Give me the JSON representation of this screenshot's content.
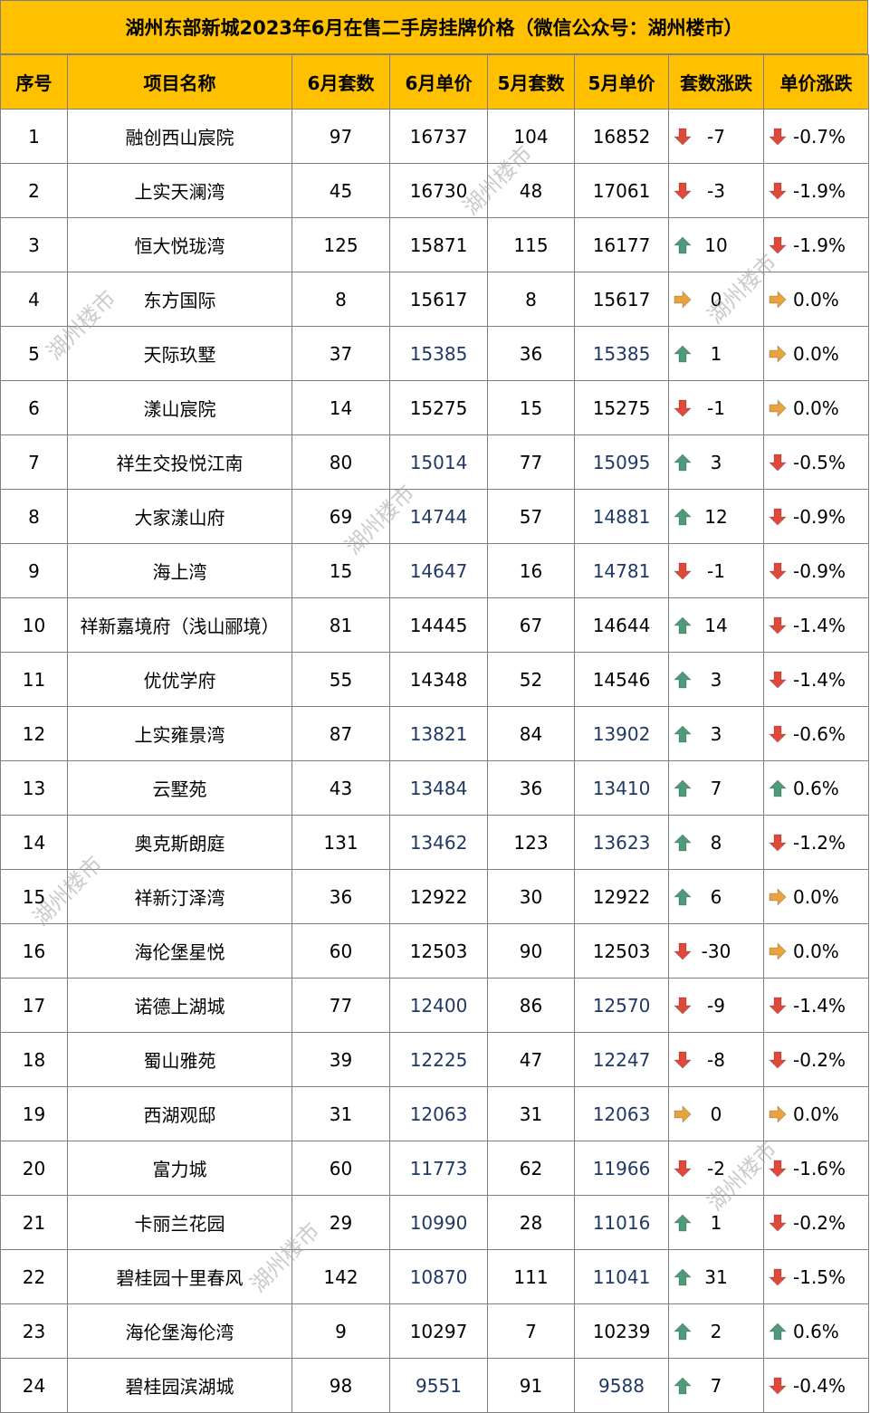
{
  "title": "湖州东部新城2023年6月在售二手房挂牌价格（微信公众号：湖州楼市）",
  "headers": [
    "序号",
    "项目名称",
    "6月套数",
    "6月单价",
    "5月套数",
    "5月单价",
    "套数涨跌",
    "单价涨跌"
  ],
  "watermark_text": "湖州楼市",
  "colors": {
    "header_bg": "#ffc000",
    "up": "#4e9a7a",
    "down": "#e0493a",
    "flat": "#e8a33c",
    "price_blue": "#1f3864"
  },
  "rows": [
    {
      "no": "1",
      "name": "融创西山宸院",
      "jun_count": "97",
      "jun_price": "16737",
      "may_count": "104",
      "may_price": "16852",
      "count_dir": "down",
      "count_change": "-7",
      "price_dir": "down",
      "price_change": "-0.7%",
      "blue": false
    },
    {
      "no": "2",
      "name": "上实天澜湾",
      "jun_count": "45",
      "jun_price": "16730",
      "may_count": "48",
      "may_price": "17061",
      "count_dir": "down",
      "count_change": "-3",
      "price_dir": "down",
      "price_change": "-1.9%",
      "blue": false
    },
    {
      "no": "3",
      "name": "恒大悦珑湾",
      "jun_count": "125",
      "jun_price": "15871",
      "may_count": "115",
      "may_price": "16177",
      "count_dir": "up",
      "count_change": "10",
      "price_dir": "down",
      "price_change": "-1.9%",
      "blue": false
    },
    {
      "no": "4",
      "name": "东方国际",
      "jun_count": "8",
      "jun_price": "15617",
      "may_count": "8",
      "may_price": "15617",
      "count_dir": "flat",
      "count_change": "0",
      "price_dir": "flat",
      "price_change": "0.0%",
      "blue": false
    },
    {
      "no": "5",
      "name": "天际玖墅",
      "jun_count": "37",
      "jun_price": "15385",
      "may_count": "36",
      "may_price": "15385",
      "count_dir": "up",
      "count_change": "1",
      "price_dir": "flat",
      "price_change": "0.0%",
      "blue": true
    },
    {
      "no": "6",
      "name": "漾山宸院",
      "jun_count": "14",
      "jun_price": "15275",
      "may_count": "15",
      "may_price": "15275",
      "count_dir": "down",
      "count_change": "-1",
      "price_dir": "flat",
      "price_change": "0.0%",
      "blue": false
    },
    {
      "no": "7",
      "name": "祥生交投悦江南",
      "jun_count": "80",
      "jun_price": "15014",
      "may_count": "77",
      "may_price": "15095",
      "count_dir": "up",
      "count_change": "3",
      "price_dir": "down",
      "price_change": "-0.5%",
      "blue": true
    },
    {
      "no": "8",
      "name": "大家漾山府",
      "jun_count": "69",
      "jun_price": "14744",
      "may_count": "57",
      "may_price": "14881",
      "count_dir": "up",
      "count_change": "12",
      "price_dir": "down",
      "price_change": "-0.9%",
      "blue": true
    },
    {
      "no": "9",
      "name": "海上湾",
      "jun_count": "15",
      "jun_price": "14647",
      "may_count": "16",
      "may_price": "14781",
      "count_dir": "down",
      "count_change": "-1",
      "price_dir": "down",
      "price_change": "-0.9%",
      "blue": true
    },
    {
      "no": "10",
      "name": "祥新嘉境府（浅山郦境）",
      "jun_count": "81",
      "jun_price": "14445",
      "may_count": "67",
      "may_price": "14644",
      "count_dir": "up",
      "count_change": "14",
      "price_dir": "down",
      "price_change": "-1.4%",
      "blue": false
    },
    {
      "no": "11",
      "name": "优优学府",
      "jun_count": "55",
      "jun_price": "14348",
      "may_count": "52",
      "may_price": "14546",
      "count_dir": "up",
      "count_change": "3",
      "price_dir": "down",
      "price_change": "-1.4%",
      "blue": false
    },
    {
      "no": "12",
      "name": "上实雍景湾",
      "jun_count": "87",
      "jun_price": "13821",
      "may_count": "84",
      "may_price": "13902",
      "count_dir": "up",
      "count_change": "3",
      "price_dir": "down",
      "price_change": "-0.6%",
      "blue": true
    },
    {
      "no": "13",
      "name": "云墅苑",
      "jun_count": "43",
      "jun_price": "13484",
      "may_count": "36",
      "may_price": "13410",
      "count_dir": "up",
      "count_change": "7",
      "price_dir": "up",
      "price_change": "0.6%",
      "blue": true
    },
    {
      "no": "14",
      "name": "奥克斯朗庭",
      "jun_count": "131",
      "jun_price": "13462",
      "may_count": "123",
      "may_price": "13623",
      "count_dir": "up",
      "count_change": "8",
      "price_dir": "down",
      "price_change": "-1.2%",
      "blue": true
    },
    {
      "no": "15",
      "name": "祥新汀泽湾",
      "jun_count": "36",
      "jun_price": "12922",
      "may_count": "30",
      "may_price": "12922",
      "count_dir": "up",
      "count_change": "6",
      "price_dir": "flat",
      "price_change": "0.0%",
      "blue": false
    },
    {
      "no": "16",
      "name": "海伦堡星悦",
      "jun_count": "60",
      "jun_price": "12503",
      "may_count": "90",
      "may_price": "12503",
      "count_dir": "down",
      "count_change": "-30",
      "price_dir": "flat",
      "price_change": "0.0%",
      "blue": false
    },
    {
      "no": "17",
      "name": "诺德上湖城",
      "jun_count": "77",
      "jun_price": "12400",
      "may_count": "86",
      "may_price": "12570",
      "count_dir": "down",
      "count_change": "-9",
      "price_dir": "down",
      "price_change": "-1.4%",
      "blue": true
    },
    {
      "no": "18",
      "name": "蜀山雅苑",
      "jun_count": "39",
      "jun_price": "12225",
      "may_count": "47",
      "may_price": "12247",
      "count_dir": "down",
      "count_change": "-8",
      "price_dir": "down",
      "price_change": "-0.2%",
      "blue": true
    },
    {
      "no": "19",
      "name": "西湖观邸",
      "jun_count": "31",
      "jun_price": "12063",
      "may_count": "31",
      "may_price": "12063",
      "count_dir": "flat",
      "count_change": "0",
      "price_dir": "flat",
      "price_change": "0.0%",
      "blue": true
    },
    {
      "no": "20",
      "name": "富力城",
      "jun_count": "60",
      "jun_price": "11773",
      "may_count": "62",
      "may_price": "11966",
      "count_dir": "down",
      "count_change": "-2",
      "price_dir": "down",
      "price_change": "-1.6%",
      "blue": true
    },
    {
      "no": "21",
      "name": "卡丽兰花园",
      "jun_count": "29",
      "jun_price": "10990",
      "may_count": "28",
      "may_price": "11016",
      "count_dir": "up",
      "count_change": "1",
      "price_dir": "down",
      "price_change": "-0.2%",
      "blue": true
    },
    {
      "no": "22",
      "name": "碧桂园十里春风",
      "jun_count": "142",
      "jun_price": "10870",
      "may_count": "111",
      "may_price": "11041",
      "count_dir": "up",
      "count_change": "31",
      "price_dir": "down",
      "price_change": "-1.5%",
      "blue": true
    },
    {
      "no": "23",
      "name": "海伦堡海伦湾",
      "jun_count": "9",
      "jun_price": "10297",
      "may_count": "7",
      "may_price": "10239",
      "count_dir": "up",
      "count_change": "2",
      "price_dir": "up",
      "price_change": "0.6%",
      "blue": false
    },
    {
      "no": "24",
      "name": "碧桂园滨湖城",
      "jun_count": "98",
      "jun_price": "9551",
      "may_count": "91",
      "may_price": "9588",
      "count_dir": "up",
      "count_change": "7",
      "price_dir": "down",
      "price_change": "-0.4%",
      "blue": true
    }
  ]
}
